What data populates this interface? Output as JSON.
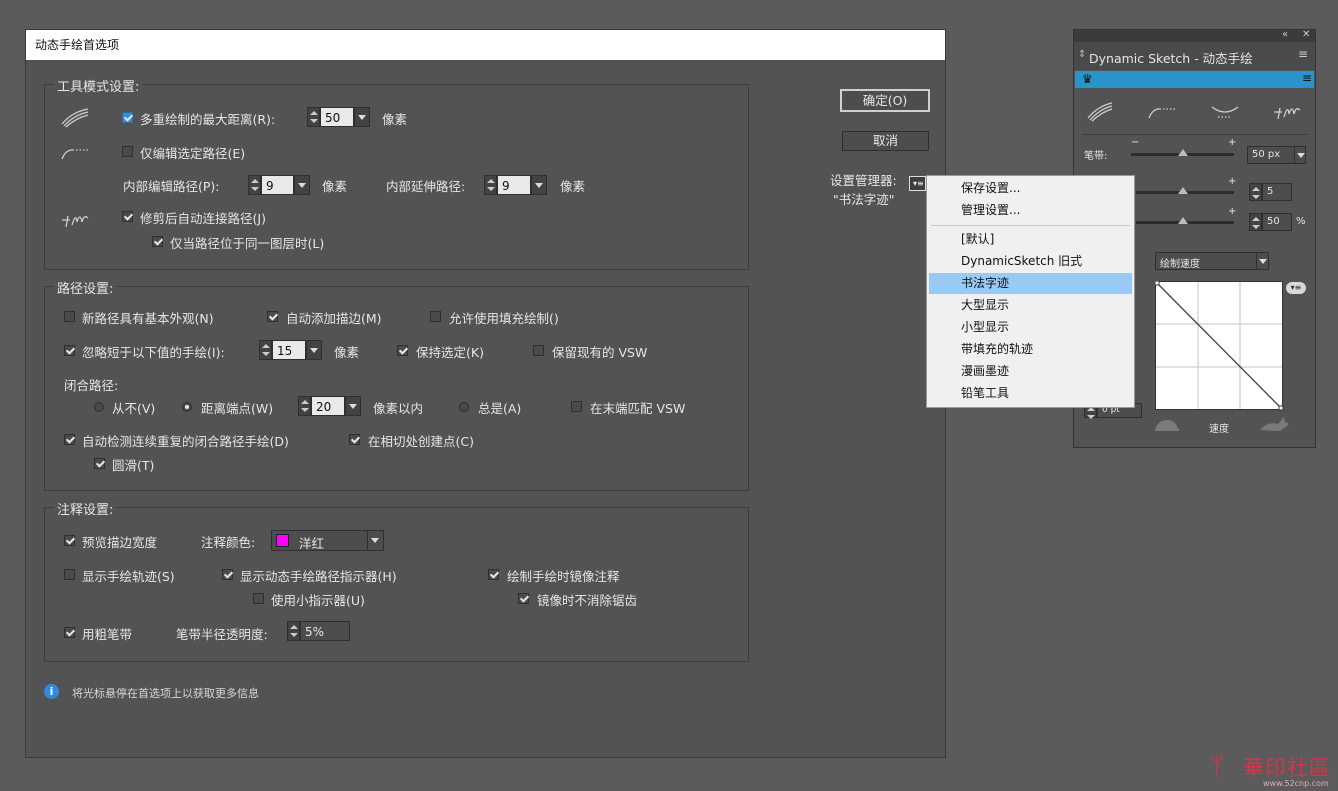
{
  "dialog": {
    "title": "动态手绘首选项",
    "tool_mode": {
      "title": "工具模式设置:",
      "max_distance_label": "多重绘制的最大距离(R):",
      "max_distance_value": "50",
      "pixel_unit": "像素",
      "edit_selected_path_label": "仅编辑选定路径(E)",
      "inner_edit_path_label": "内部编辑路径(P):",
      "inner_edit_path_value": "9",
      "inner_extend_path_label": "内部延伸路径:",
      "inner_extend_path_value": "9",
      "auto_connect_label": "修剪后自动连接路径(J)",
      "same_layer_label": "仅当路径位于同一图层时(L)"
    },
    "path_settings": {
      "title": "路径设置:",
      "basic_appearance_label": "新路径具有基本外观(N)",
      "auto_add_stroke_label": "自动添加描边(M)",
      "allow_fill_label": "允许使用填充绘制()",
      "ignore_short_label": "忽略短于以下值的手绘(I):",
      "ignore_short_value": "15",
      "pixel_unit": "像素",
      "keep_selected_label": "保持选定(K)",
      "keep_vsw_label": "保留现有的 VSW",
      "close_path_label": "闭合路径:",
      "never_label": "从不(V)",
      "distance_endpoint_label": "距离端点(W)",
      "distance_value": "20",
      "within_pixels_label": "像素以内",
      "always_label": "总是(A)",
      "match_vsw_label": "在末端匹配 VSW",
      "auto_detect_label": "自动检测连续重复的闭合路径手绘(D)",
      "tangent_anchor_label": "在相切处创建点(C)",
      "smooth_label": "圆滑(T)"
    },
    "annotation": {
      "title": "注释设置:",
      "preview_stroke_label": "预览描边宽度",
      "annotation_color_label": "注释颜色:",
      "annotation_color_value": "洋红",
      "annotation_color_hex": "#ff00ff",
      "show_track_label": "显示手绘轨迹(S)",
      "show_indicator_label": "显示动态手绘路径指示器(H)",
      "mirror_annotation_label": "绘制手绘时镜像注释",
      "small_indicator_label": "使用小指示器(U)",
      "no_antialias_label": "镜像时不消除锯齿",
      "thick_brush_label": "用粗笔带",
      "brush_opacity_label": "笔带半径透明度:",
      "brush_opacity_value": "5%"
    },
    "ok_label": "确定(O)",
    "cancel_label": "取消",
    "settings_manager_label": "设置管理器:",
    "settings_manager_value": "\"书法字迹\"",
    "info_text": "将光标悬停在首选项上以获取更多信息"
  },
  "menu": {
    "items_top": [
      "保存设置...",
      "管理设置..."
    ],
    "items_presets": [
      "[默认]",
      "DynamicSketch 旧式",
      "书法字迹",
      "大型显示",
      "小型显示",
      "带填充的轨迹",
      "漫画墨迹",
      "铅笔工具"
    ],
    "selected": "书法字迹"
  },
  "panel": {
    "title": "Dynamic Sketch - 动态手绘",
    "brush_label": "笔带:",
    "brush_value": "50 px",
    "value2": "5",
    "value3": "50",
    "percent": "%",
    "mode_value": "绘制速度",
    "min_value": "0 pt",
    "speed_label": "速度",
    "minus": "−",
    "plus": "+"
  },
  "watermark": {
    "text": "華印社區",
    "url": "www.52cnp.com"
  }
}
